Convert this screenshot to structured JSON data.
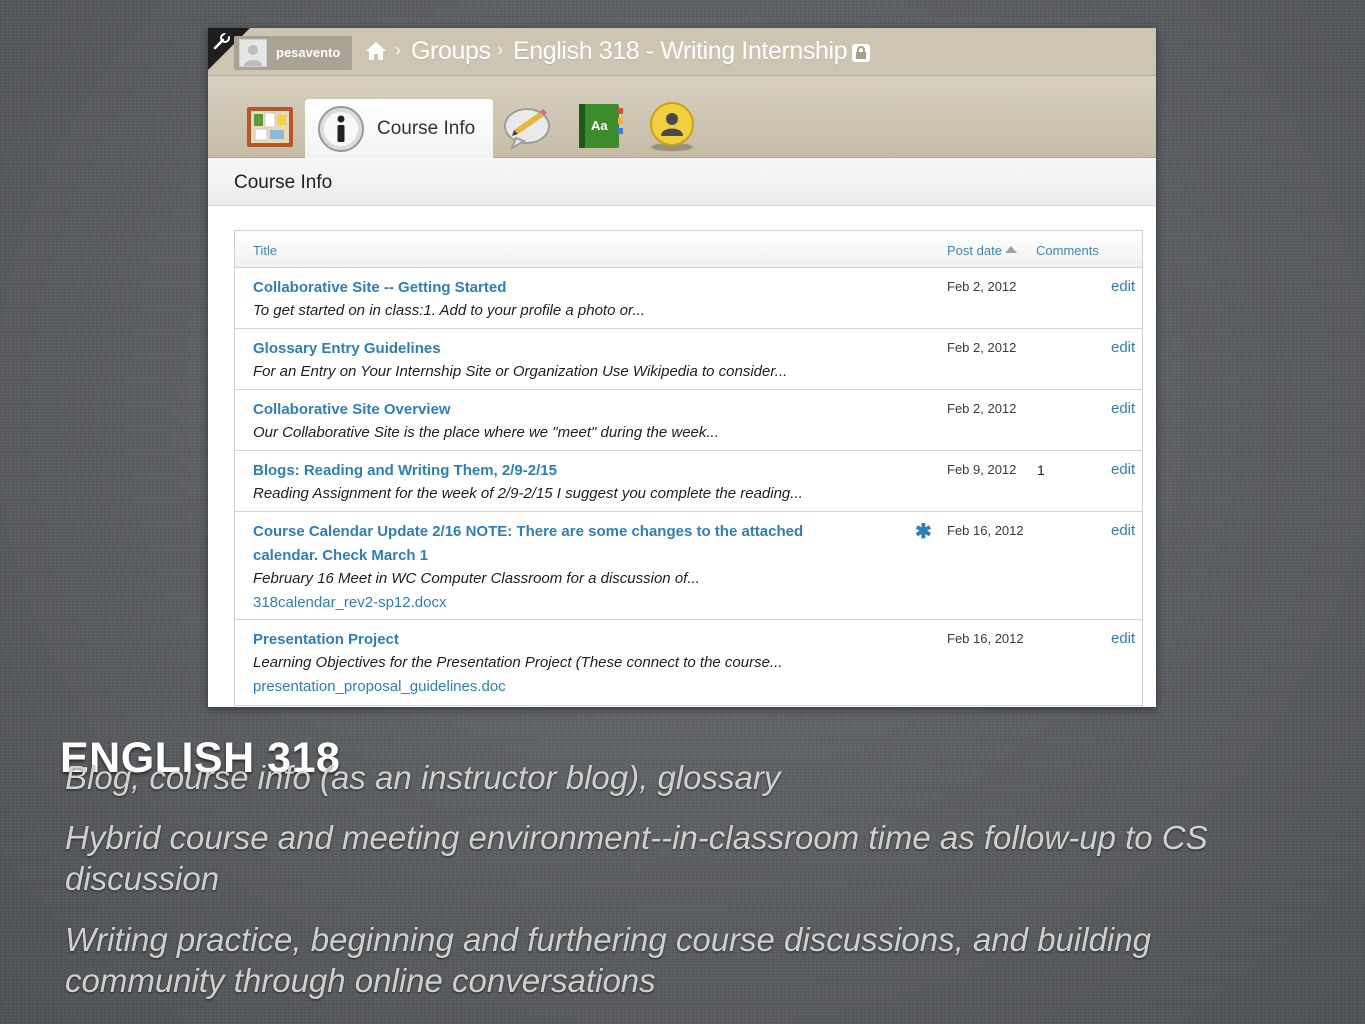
{
  "topbar": {
    "username": "pesavento",
    "breadcrumbs": [
      "Groups",
      "English 318 - Writing Internship"
    ]
  },
  "tabs": {
    "active_label": "Course Info"
  },
  "section_title": "Course Info",
  "table": {
    "headers": {
      "title": "Title",
      "post_date": "Post date",
      "comments": "Comments"
    },
    "rows": [
      {
        "title": "Collaborative Site -- Getting Started",
        "excerpt": "To get started on in class:1.    Add to your profile a photo or...",
        "date": "Feb 2, 2012",
        "comments": "",
        "edit": "edit"
      },
      {
        "title": "Glossary Entry Guidelines",
        "excerpt": "For an Entry on Your Internship Site or Organization Use Wikipedia to consider...",
        "date": "Feb 2, 2012",
        "comments": "",
        "edit": "edit"
      },
      {
        "title": "Collaborative Site Overview",
        "excerpt": "Our Collaborative Site is the place where we \"meet\" during the week...",
        "date": "Feb 2, 2012",
        "comments": "",
        "edit": "edit"
      },
      {
        "title": "Blogs: Reading and Writing Them, 2/9-2/15",
        "excerpt": "Reading Assignment for the week of 2/9-2/15 I suggest you complete the reading...",
        "date": "Feb 9, 2012",
        "comments": "1",
        "edit": "edit"
      },
      {
        "title": "Course Calendar Update 2/16 NOTE: There are some changes to the attached calendar. Check March 1",
        "excerpt": "February 16   Meet in WC Computer Classroom for a discussion of...",
        "attachment": "318calendar_rev2-sp12.docx",
        "marker": "✱",
        "date": "Feb 16, 2012",
        "comments": "",
        "edit": "edit"
      },
      {
        "title": "Presentation Project",
        "excerpt": "Learning Objectives for the Presentation Project (These connect to the course...",
        "attachment": "presentation_proposal_guidelines.doc",
        "date": "Feb 16, 2012",
        "comments": "",
        "edit": "edit"
      }
    ]
  },
  "slide": {
    "title": "ENGLISH 318",
    "bullets": [
      "Blog, course info (as an instructor blog), glossary",
      "Hybrid course and meeting environment--in-classroom time as follow-up to CS discussion",
      "Writing practice, beginning and furthering course discussions, and building community through online conversations"
    ]
  },
  "colors": {
    "link": "#2e7fb8",
    "topbar": "#cdc4b1",
    "slide_background": "#5b5e61"
  },
  "icons": {
    "tabs": [
      "bulletin-board-icon",
      "info-icon",
      "blog-pencil-icon",
      "glossary-book-icon",
      "member-profile-icon"
    ]
  }
}
